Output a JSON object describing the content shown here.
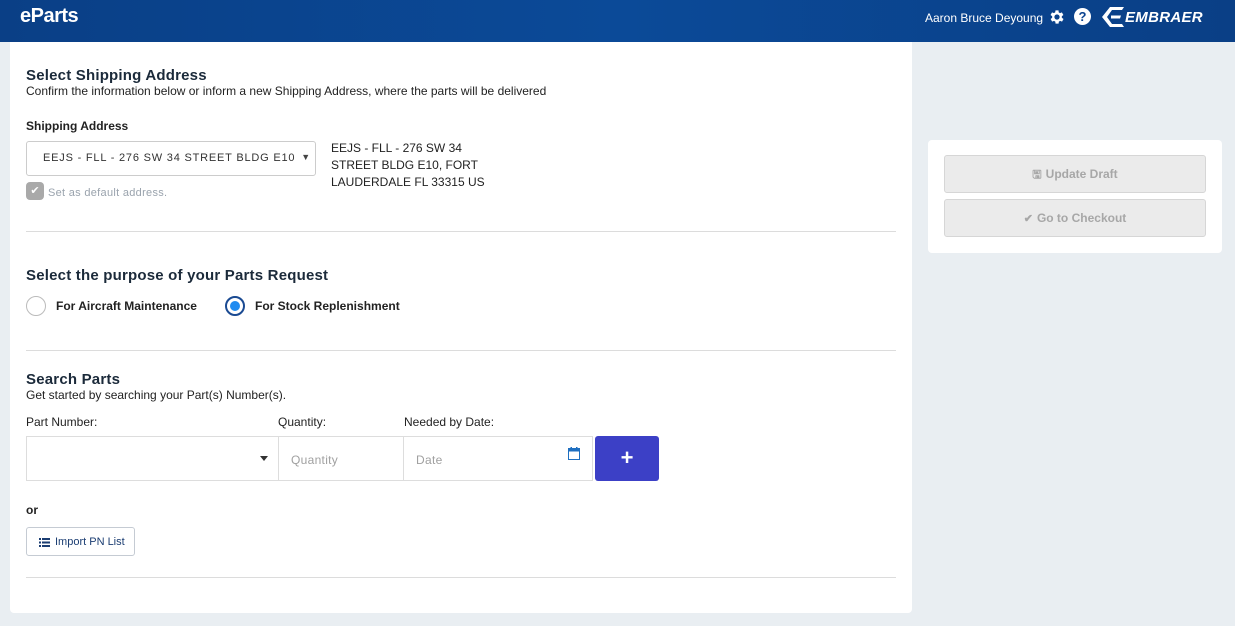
{
  "header": {
    "brand": "eParts",
    "user_name": "Aaron Bruce Deyoung",
    "logo_text": "EMBRAER",
    "help_glyph": "?"
  },
  "shipping": {
    "title": "Select Shipping Address",
    "subtitle": "Confirm the information below or inform a new Shipping Address, where the parts will be delivered",
    "label": "Shipping Address",
    "selected_value": "EEJS - FLL - 276 SW 34 STREET BLDG E10",
    "default_checkbox_label": "Set as default address.",
    "default_checked": true,
    "address_lines": [
      "EEJS - FLL - 276 SW 34",
      "STREET BLDG E10, FORT",
      "LAUDERDALE FL 33315 US"
    ]
  },
  "purpose": {
    "title": "Select the purpose of your Parts Request",
    "options": [
      {
        "label": "For Aircraft Maintenance",
        "selected": false
      },
      {
        "label": "For Stock Replenishment",
        "selected": true
      }
    ]
  },
  "search": {
    "title": "Search Parts",
    "subtitle": "Get started by searching your Part(s) Number(s).",
    "part_number_label": "Part Number:",
    "quantity_label": "Quantity:",
    "date_label": "Needed by Date:",
    "quantity_placeholder": "Quantity",
    "date_placeholder": "Date",
    "add_glyph": "+",
    "or_text": "or",
    "import_label": "Import PN List"
  },
  "side": {
    "update_draft_label": "Update Draft",
    "checkout_label": "Go to Checkout",
    "update_icon": "floppy-icon",
    "checkout_icon": "check-icon"
  },
  "colors": {
    "header_bg": "#0b4390",
    "primary_button": "#3c40c6",
    "radio_selected": "#1f8bf0",
    "disabled_button": "#ebebeb"
  }
}
